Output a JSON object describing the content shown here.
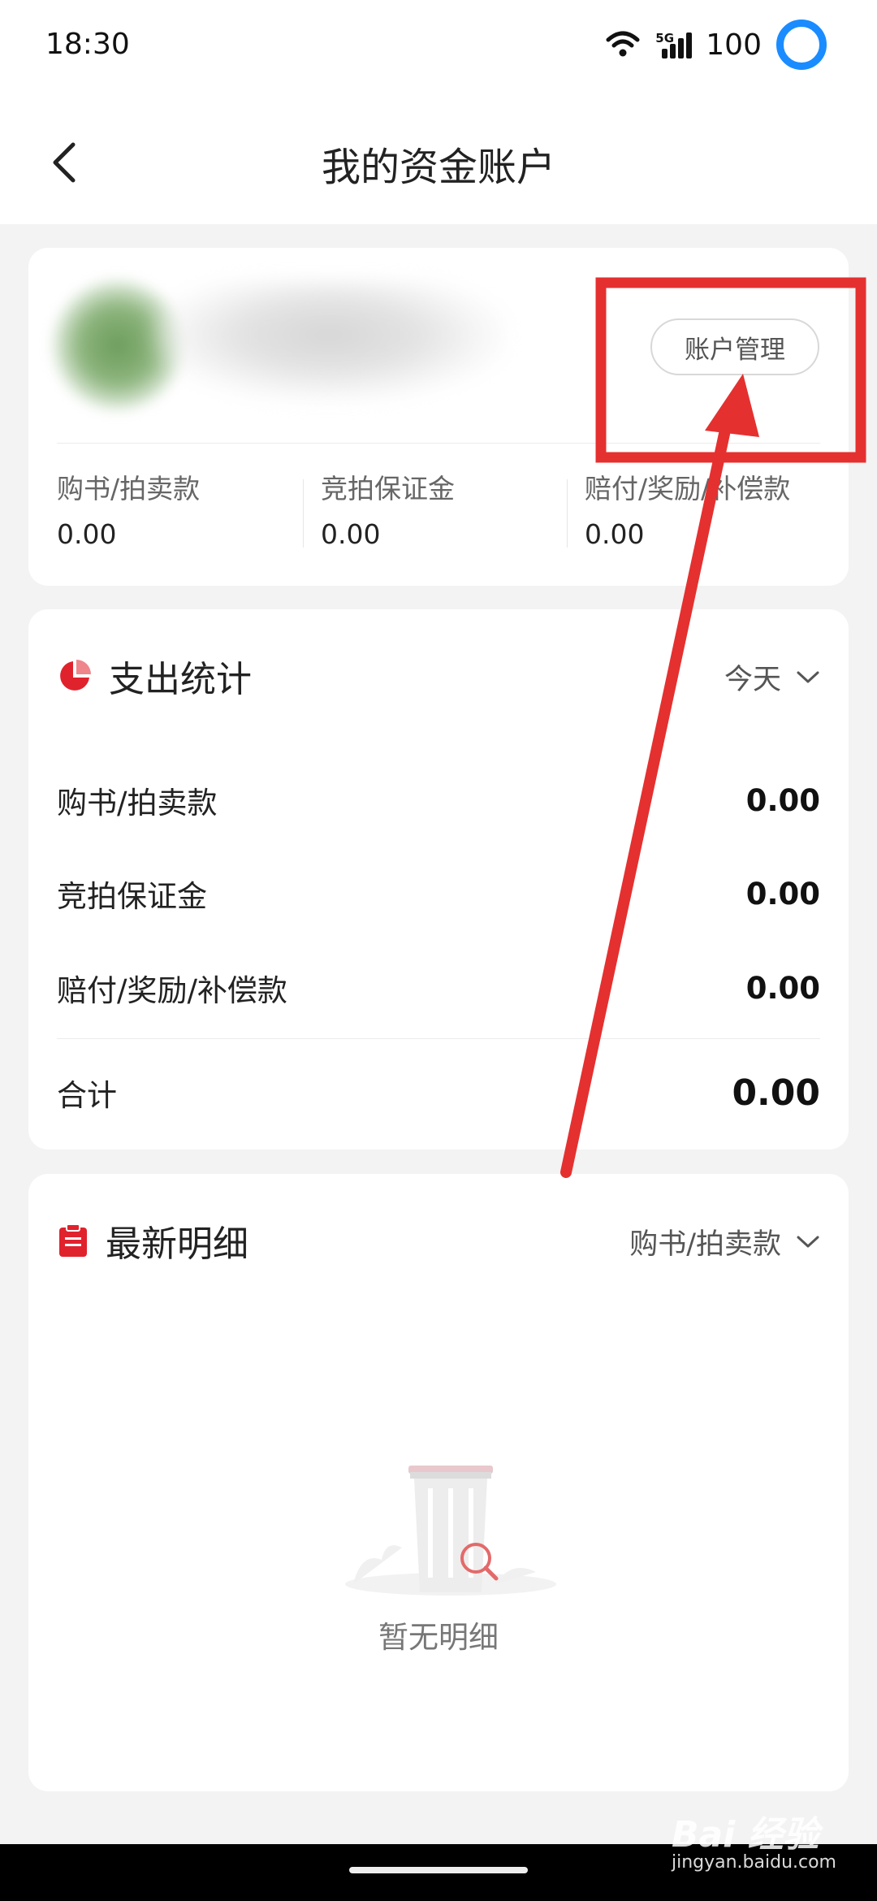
{
  "status_bar": {
    "time": "18:30",
    "network": "5G",
    "battery": "100",
    "icons": [
      "wifi-icon",
      "signal-icon",
      "battery-ring-icon"
    ]
  },
  "header": {
    "title": "我的资金账户",
    "back_icon": "back-chevron-icon"
  },
  "account": {
    "manage_button": "账户管理",
    "balances": [
      {
        "label": "购书/拍卖款",
        "value": "0.00"
      },
      {
        "label": "竞拍保证金",
        "value": "0.00"
      },
      {
        "label": "赔付/奖励/补偿款",
        "value": "0.00"
      }
    ]
  },
  "stats": {
    "title": "支出统计",
    "period": "今天",
    "rows": [
      {
        "label": "购书/拍卖款",
        "value": "0.00"
      },
      {
        "label": "竞拍保证金",
        "value": "0.00"
      },
      {
        "label": "赔付/奖励/补偿款",
        "value": "0.00"
      }
    ],
    "total_label": "合计",
    "total_value": "0.00"
  },
  "details": {
    "title": "最新明细",
    "filter": "购书/拍卖款",
    "empty_text": "暂无明细"
  },
  "watermark": {
    "text": "Bai 经验",
    "sub": "jingyan.baidu.com"
  },
  "colors": {
    "accent": "#e0222d",
    "annotation": "#e53030",
    "status_ring": "#1a8cff"
  }
}
